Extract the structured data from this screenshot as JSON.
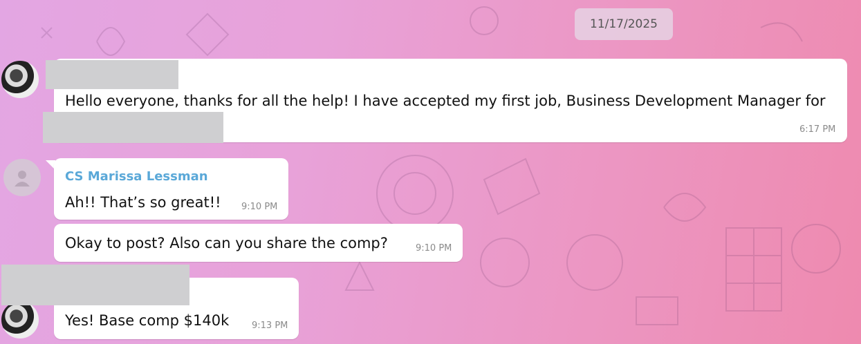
{
  "chat": {
    "date_label": "11/17/2025",
    "messages": [
      {
        "sender": "",
        "text": "Hello everyone, thanks for all the help! I have accepted my first job, Business Development Manager for",
        "time": "6:17 PM"
      },
      {
        "sender": "CS Marissa Lessman",
        "text": "Ah!! That’s so great!!",
        "time": "9:10 PM"
      },
      {
        "sender": "CS Marissa Lessman",
        "text": "Okay to post? Also can you share the comp?",
        "time": "9:10 PM"
      },
      {
        "sender": "",
        "text": "Yes! Base comp $140k",
        "time": "9:13 PM"
      }
    ]
  },
  "colors": {
    "sender_name": "#5aa8d8",
    "bubble": "#ffffff",
    "redaction": "#cfcfd1"
  }
}
